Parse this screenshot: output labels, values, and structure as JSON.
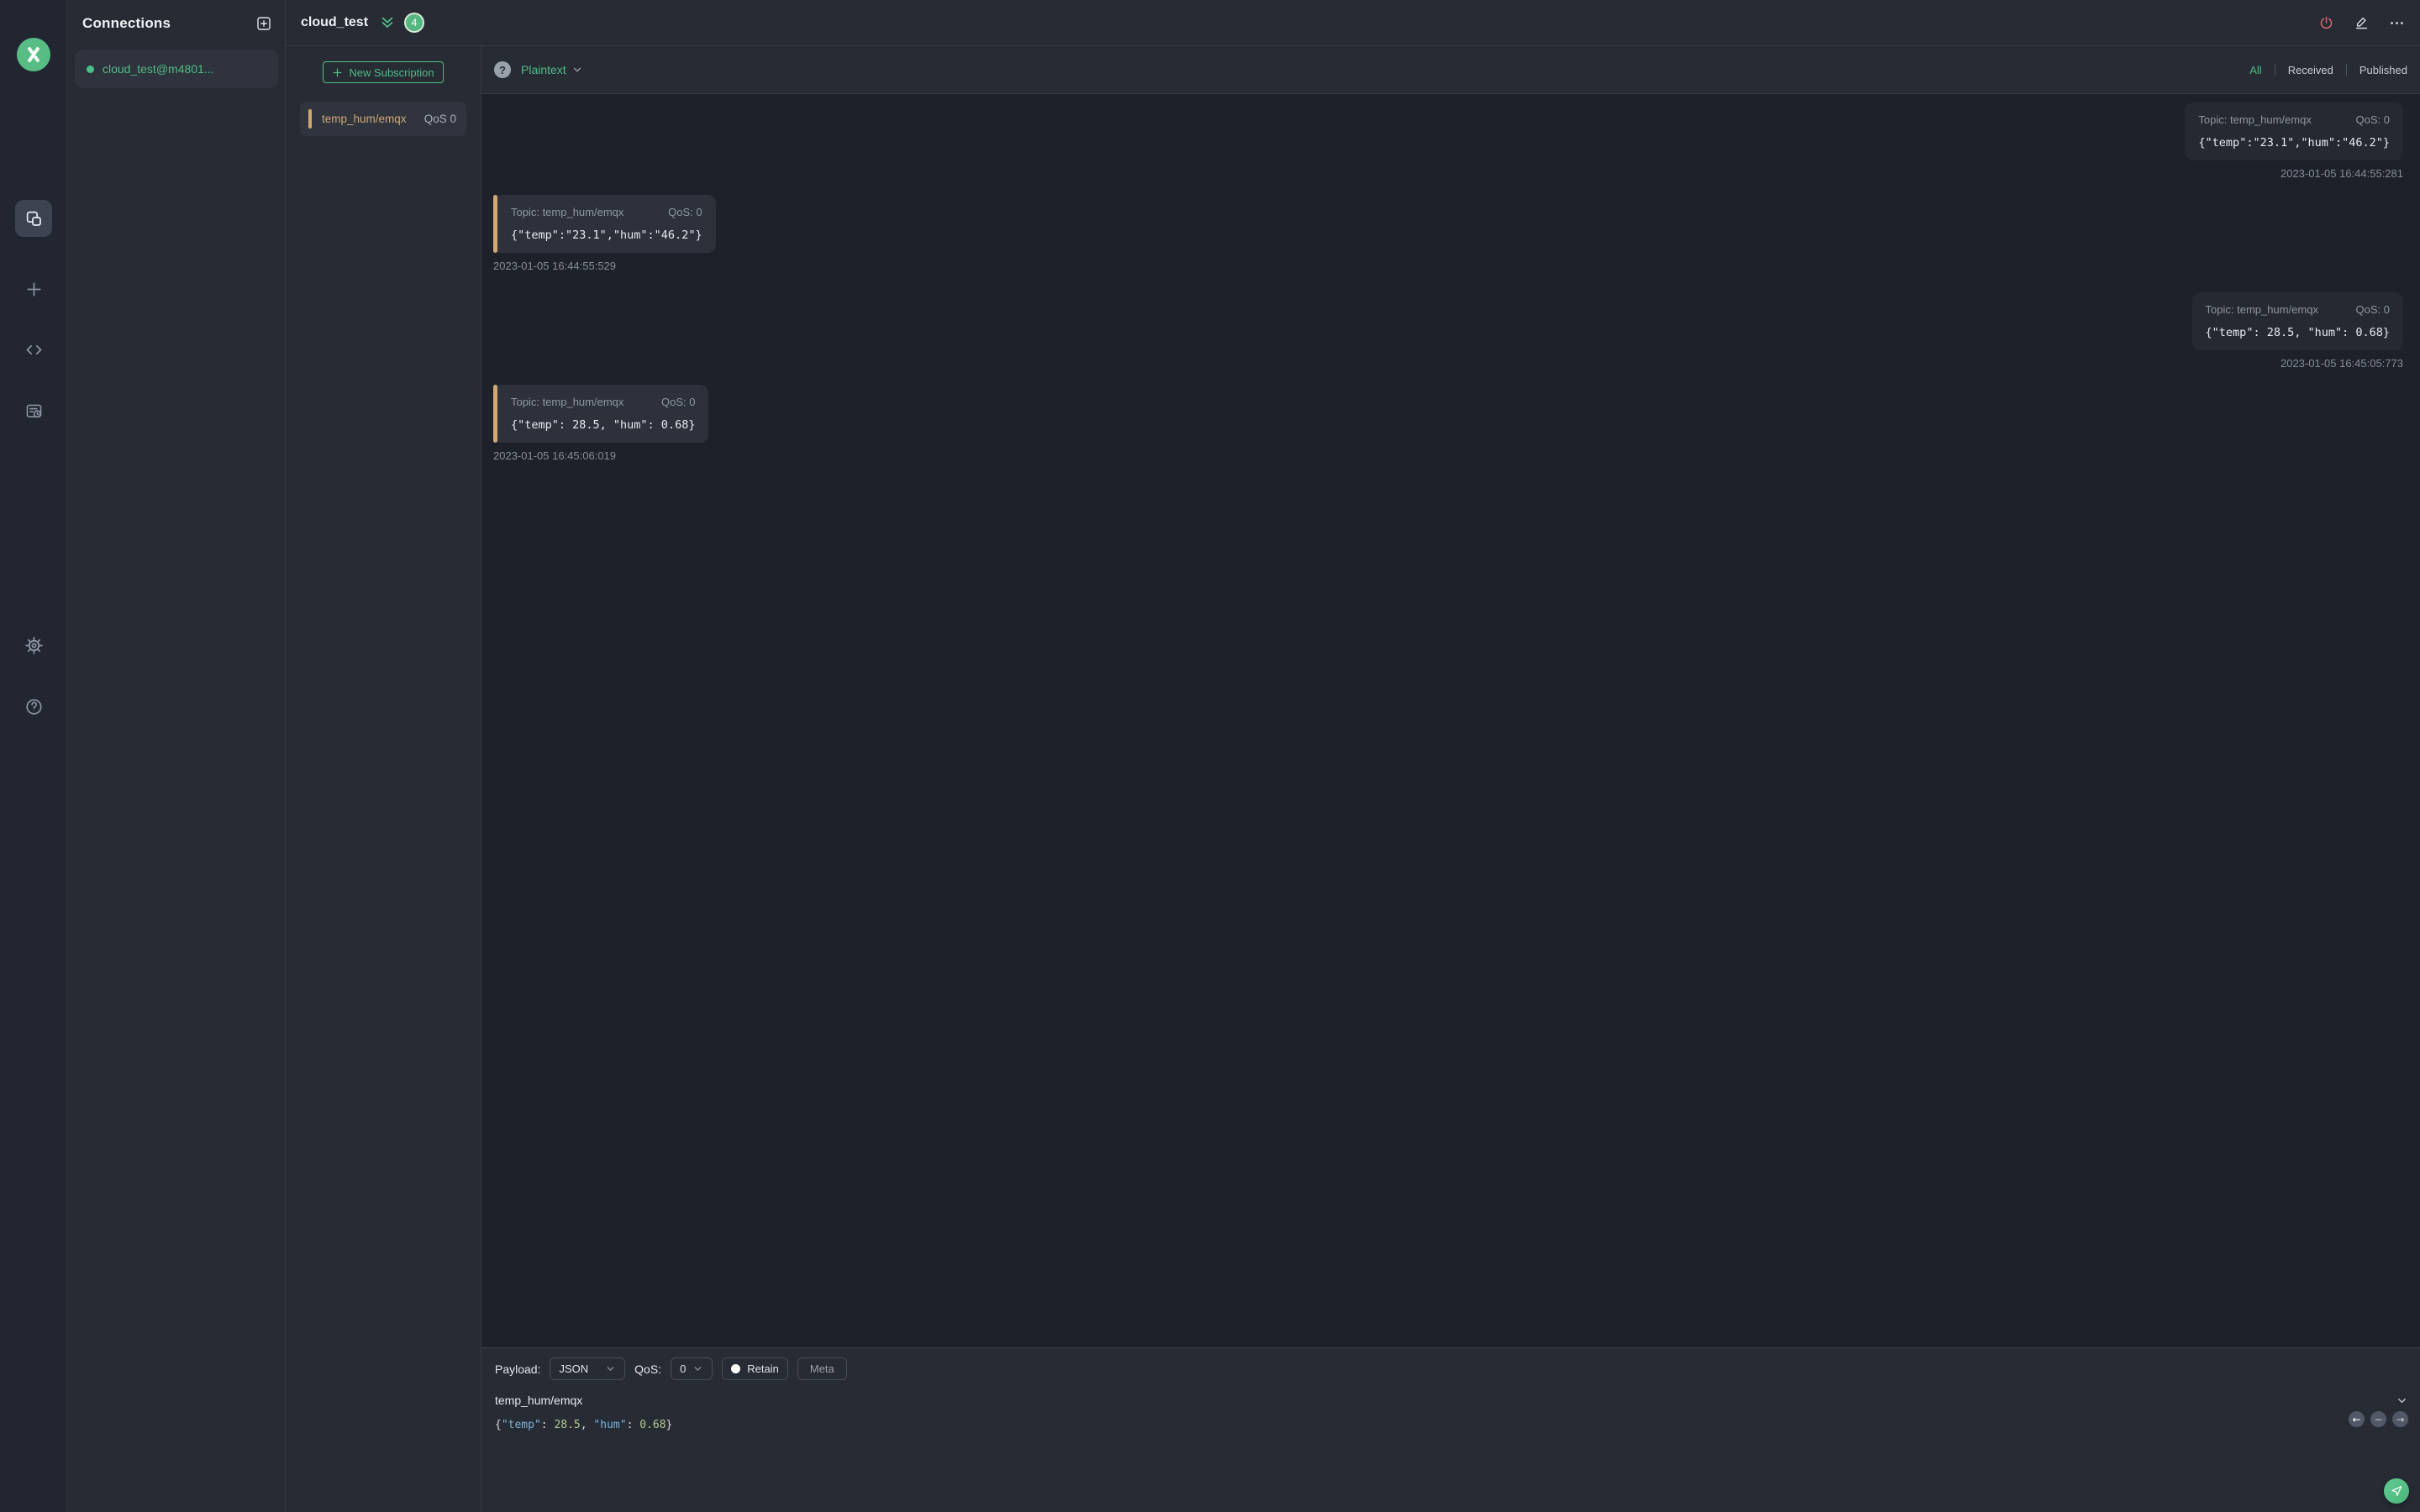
{
  "colors": {
    "accent": "#4ebd87",
    "orange": "#d2a871",
    "red": "#e0696f"
  },
  "iconbar": {
    "logo": "mqttx-logo",
    "items": [
      "connections",
      "new-connection",
      "script",
      "log"
    ],
    "bottom_items": [
      "settings",
      "help"
    ]
  },
  "connections_panel": {
    "title": "Connections",
    "items": [
      {
        "name": "cloud_test@m4801...",
        "status": "connected"
      }
    ]
  },
  "header": {
    "title": "cloud_test",
    "badge_count": "4"
  },
  "subscriptions": {
    "new_button_label": "New Subscription",
    "items": [
      {
        "topic": "temp_hum/emqx",
        "qos": "QoS 0"
      }
    ]
  },
  "filter_bar": {
    "format_selected": "Plaintext",
    "help_glyph": "?",
    "tabs": [
      {
        "label": "All",
        "active": true
      },
      {
        "label": "Received",
        "active": false
      },
      {
        "label": "Published",
        "active": false
      }
    ]
  },
  "messages": [
    {
      "side": "right",
      "topic_label": "Topic: temp_hum/emqx",
      "qos_label": "QoS: 0",
      "payload": "{\"temp\":\"23.1\",\"hum\":\"46.2\"}",
      "time": "2023-01-05 16:44:55:281"
    },
    {
      "side": "left",
      "topic_label": "Topic: temp_hum/emqx",
      "qos_label": "QoS: 0",
      "payload": "{\"temp\":\"23.1\",\"hum\":\"46.2\"}",
      "time": "2023-01-05 16:44:55:529"
    },
    {
      "side": "right",
      "topic_label": "Topic: temp_hum/emqx",
      "qos_label": "QoS: 0",
      "payload": "{\"temp\": 28.5, \"hum\": 0.68}",
      "time": "2023-01-05 16:45:05:773"
    },
    {
      "side": "left",
      "topic_label": "Topic: temp_hum/emqx",
      "qos_label": "QoS: 0",
      "payload": "{\"temp\": 28.5, \"hum\": 0.68}",
      "time": "2023-01-05 16:45:06:019"
    }
  ],
  "publish": {
    "payload_label": "Payload:",
    "payload_type": "JSON",
    "qos_label": "QoS:",
    "qos_value": "0",
    "retain_label": "Retain",
    "meta_label": "Meta",
    "topic": "temp_hum/emqx",
    "nav": {
      "back": "←",
      "minus": "−",
      "forward": "→"
    },
    "editor_line": {
      "open": "{",
      "key1": "\"temp\"",
      "sep1": ": ",
      "num1": "28.5",
      "comma": ", ",
      "key2": "\"hum\"",
      "sep2": ": ",
      "num2": "0.68",
      "close": "}"
    }
  }
}
